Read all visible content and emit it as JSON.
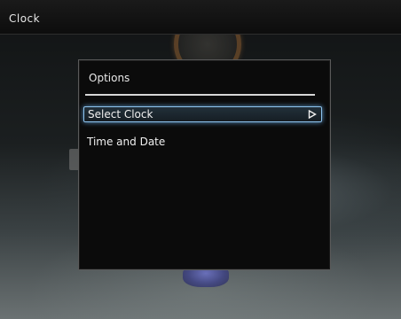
{
  "header": {
    "title": "Clock"
  },
  "panel": {
    "title": "Options",
    "items": [
      {
        "label": "Select Clock",
        "selected": true,
        "has_submenu_icon": "play-arrow-icon"
      },
      {
        "label": "Time and Date",
        "selected": false
      }
    ]
  },
  "colors": {
    "selection_outline": "#8ec5f0",
    "panel_background": "#0b0b0b",
    "text": "#f0f0f0"
  }
}
